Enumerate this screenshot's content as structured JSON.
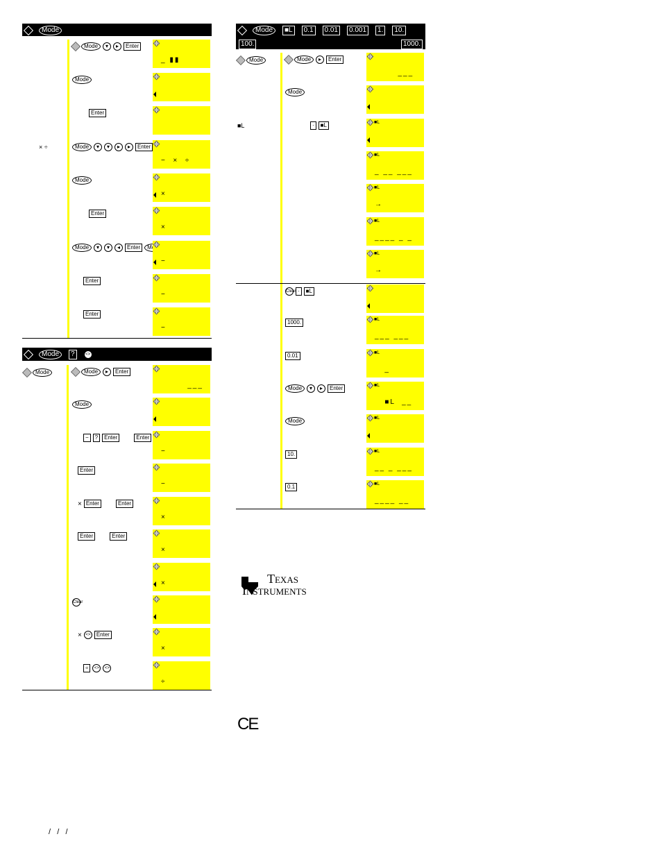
{
  "panels": [
    {
      "header": [
        "diamond",
        "Mode"
      ],
      "left": [
        {
          "row": 3,
          "text": "×  ÷"
        }
      ],
      "rows": [
        {
          "keys": [
            "diamond",
            "Mode",
            "down",
            "right",
            "Enter"
          ],
          "display": "_ ▮▮",
          "arrow": false
        },
        {
          "keys": [
            "Mode"
          ],
          "display": "",
          "arrow": true
        },
        {
          "keys": [
            "Enter"
          ],
          "display": "",
          "arrow": false,
          "indent": 24
        },
        {
          "keys": [
            "Mode",
            "down",
            "down",
            "right",
            "right",
            "Enter"
          ],
          "display": "−  ×  ÷",
          "arrow": false
        },
        {
          "keys": [
            "Mode"
          ],
          "display": "×",
          "arrow": true
        },
        {
          "keys": [
            "Enter"
          ],
          "display": "×",
          "arrow": false,
          "indent": 24
        },
        {
          "keys": [
            "Mode",
            "down",
            "down",
            "left",
            "Enter",
            "Mode"
          ],
          "display": "−",
          "arrow": true
        },
        {
          "keys": [
            "Enter"
          ],
          "display": "−",
          "arrow": false,
          "indent": 16
        },
        {
          "keys": [
            "Enter"
          ],
          "display": "−",
          "arrow": false,
          "indent": 16
        }
      ]
    },
    {
      "header": [
        "diamond",
        "Mode",
        "?",
        "<>"
      ],
      "left": [
        {
          "row": 0,
          "text": "",
          "keys": [
            "diamond",
            "Mode"
          ]
        }
      ],
      "rows": [
        {
          "keys": [
            "diamond",
            "Mode",
            "right",
            "Enter"
          ],
          "display": "        ___",
          "arrow": false
        },
        {
          "keys": [
            "Mode"
          ],
          "display": "",
          "arrow": true
        },
        {
          "keys": [
            "−",
            "?",
            "Enter",
            "Enter"
          ],
          "display": "−",
          "arrow": false,
          "indent": 16
        },
        {
          "keys": [
            "Enter"
          ],
          "display": "−",
          "arrow": false,
          "indent": 8
        },
        {
          "keys": [
            "×",
            "Enter",
            "Enter"
          ],
          "display": "×",
          "arrow": false,
          "indent": 8
        },
        {
          "keys": [
            "Enter",
            "Enter"
          ],
          "display": "×",
          "arrow": false,
          "indent": 8
        },
        {
          "keys": [],
          "display": "×",
          "arrow": true
        },
        {
          "keys": [
            "Clear"
          ],
          "display": "",
          "arrow": true
        },
        {
          "keys": [
            "×",
            "<>",
            "Enter"
          ],
          "display": "×",
          "arrow": false,
          "indent": 8
        },
        {
          "keys": [
            "÷",
            "<>",
            "<>"
          ],
          "display": "÷",
          "arrow": false,
          "indent": 16
        }
      ]
    },
    {
      "header": [
        "diamond",
        "Mode",
        "■L",
        "0.1",
        "0.01",
        "0.001",
        "1.",
        "10.",
        "100.",
        "1000."
      ],
      "left": [
        {
          "row": 0,
          "text": "",
          "keys": [
            "diamond",
            "Mode"
          ]
        },
        {
          "row": 2,
          "text": "■L"
        }
      ],
      "rows": [
        {
          "keys": [
            "diamond",
            "Mode",
            "right",
            "Enter"
          ],
          "display": "       ___",
          "arrow": false
        },
        {
          "keys": [
            "Mode"
          ],
          "display": "",
          "arrow": true
        },
        {
          "keys": [
            "·",
            "■L"
          ],
          "display": "",
          "arrow": true,
          "ind": "■L",
          "indent": 36
        },
        {
          "keys": [],
          "display": "_ __ ___",
          "arrow": false,
          "ind": "■L"
        },
        {
          "keys": [],
          "display": "→",
          "arrow": false,
          "ind": "■L"
        },
        {
          "keys": [],
          "display": "____ _ _",
          "arrow": false,
          "ind": "■L"
        },
        {
          "keys": [],
          "display": "→",
          "arrow": false,
          "ind": "■L"
        },
        {
          "keys": [
            "Clear",
            "·",
            "■L"
          ],
          "display": "",
          "arrow": true
        },
        {
          "keys": [
            "1000."
          ],
          "display": "___ ___",
          "arrow": false,
          "ind": "■L"
        },
        {
          "keys": [
            "0.01"
          ],
          "display": "   _",
          "arrow": false,
          "ind": "■L"
        },
        {
          "keys": [
            "Mode",
            "down",
            "right",
            "Enter"
          ],
          "display": "   ■L  __",
          "arrow": false,
          "ind": "■L"
        },
        {
          "keys": [
            "Mode"
          ],
          "display": "",
          "arrow": true,
          "ind": "■L"
        },
        {
          "keys": [
            "10."
          ],
          "display": "__ _ ___",
          "arrow": false,
          "ind": "■L"
        },
        {
          "keys": [
            "0.1"
          ],
          "display": "____ __",
          "arrow": false,
          "ind": "■L"
        }
      ]
    }
  ],
  "logo": {
    "line1": "Texas",
    "line2": "Instruments"
  },
  "ce_mark": "CE",
  "footer_date": "/   /   /"
}
